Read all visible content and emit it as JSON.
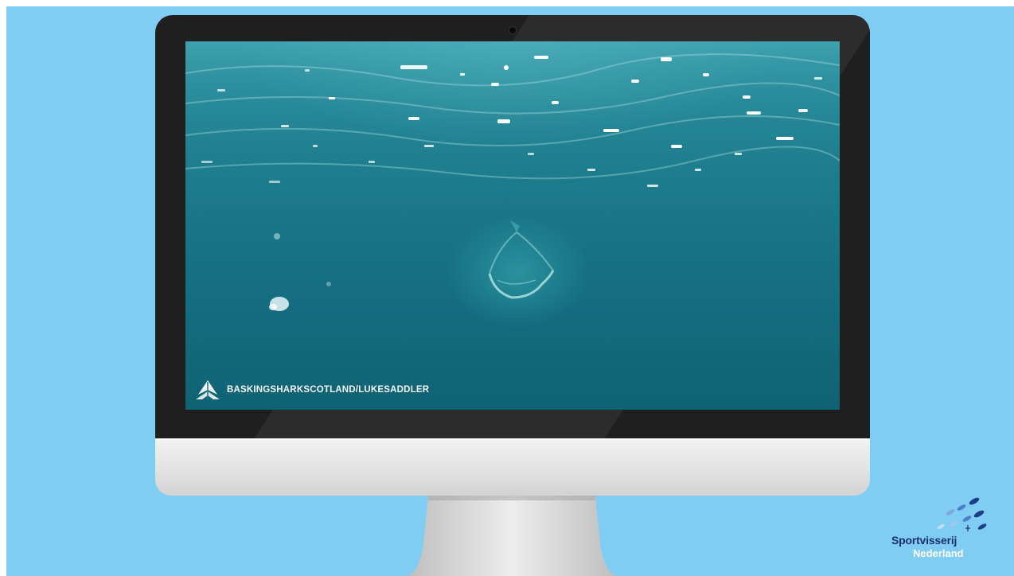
{
  "video": {
    "credit": "BASKINGSHARKSCOTLAND/LUKESADDLER",
    "subject": "basking shark swimming underwater with open mouth"
  },
  "branding": {
    "line1": "Sportvisserij",
    "line2": "Nederland"
  },
  "colors": {
    "background": "#7fcdf2",
    "bezel": "#1f1f1f",
    "water": "#1a7888",
    "logo_dark": "#1b2f6e",
    "logo_light": "#ffffff"
  }
}
